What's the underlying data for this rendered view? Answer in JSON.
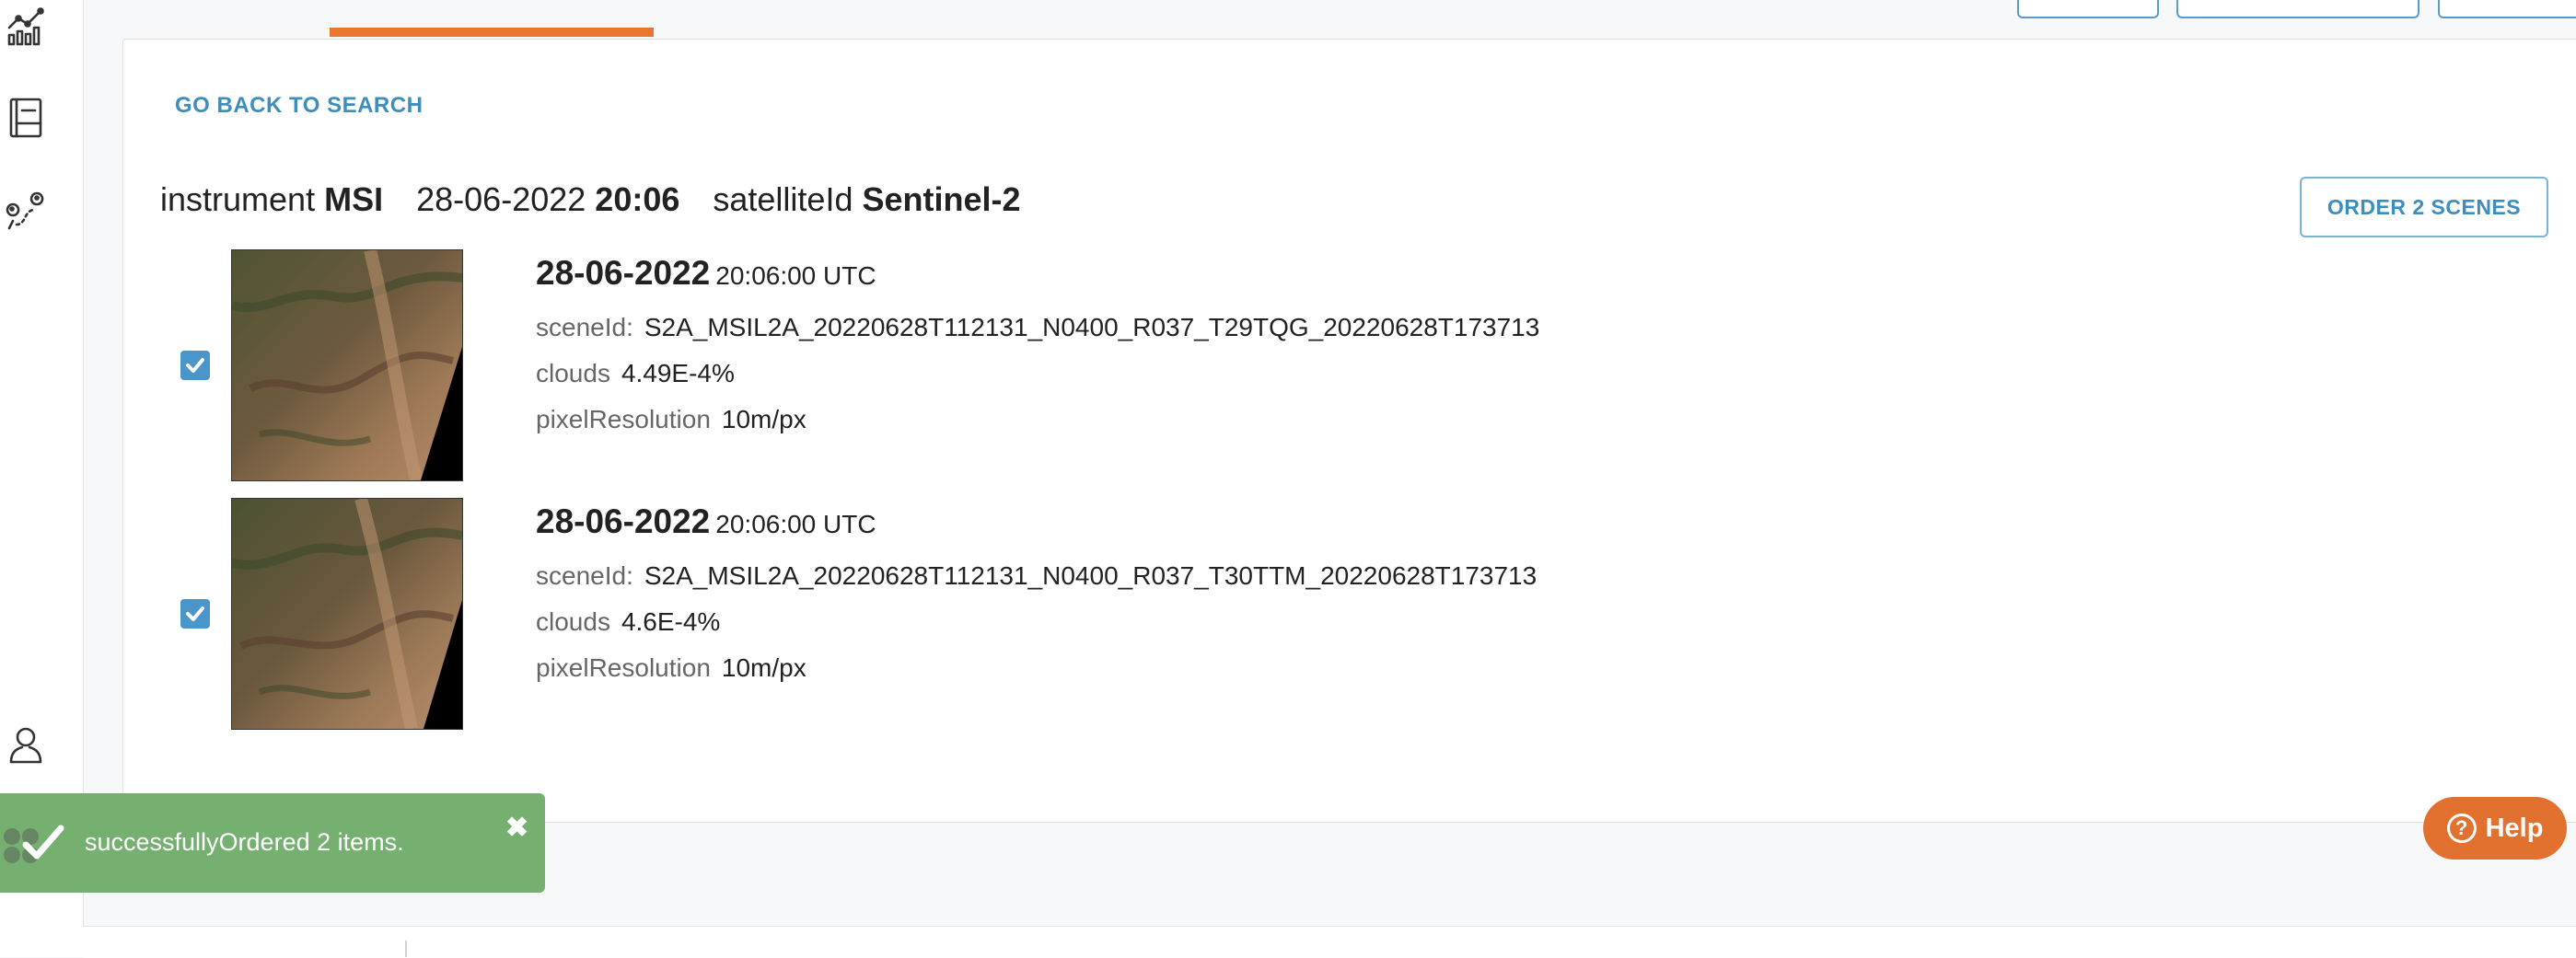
{
  "sidebar": {
    "icons": [
      "chart-icon",
      "notebook-icon",
      "route-icon",
      "user-icon"
    ]
  },
  "actions": {
    "go_back": "GO BACK TO SEARCH",
    "order": "ORDER 2 SCENES"
  },
  "group": {
    "instrument_label": "instrument",
    "instrument_value": "MSI",
    "date": "28-06-2022",
    "time": "20:06",
    "satellite_label": "satelliteId",
    "satellite_value": "Sentinel-2"
  },
  "scenes": [
    {
      "checked": true,
      "date": "28-06-2022",
      "time": "20:06:00 UTC",
      "scene_label": "sceneId:",
      "scene_id": "S2A_MSIL2A_20220628T112131_N0400_R037_T29TQG_20220628T173713",
      "clouds_label": "clouds",
      "clouds": "4.49E-4%",
      "resolution_label": "pixelResolution",
      "resolution": "10m/px"
    },
    {
      "checked": true,
      "date": "28-06-2022",
      "time": "20:06:00 UTC",
      "scene_label": "sceneId:",
      "scene_id": "S2A_MSIL2A_20220628T112131_N0400_R037_T30TTM_20220628T173713",
      "clouds_label": "clouds",
      "clouds": "4.6E-4%",
      "resolution_label": "pixelResolution",
      "resolution": "10m/px"
    }
  ],
  "toast": {
    "message": "successfullyOrdered 2 items.",
    "close": "✖"
  },
  "help": {
    "label": "Help",
    "icon": "?"
  },
  "colors": {
    "accent": "#3d8dbd",
    "tab_active": "#e8772e",
    "toast_bg": "#76b070",
    "help_bg": "#e2702e",
    "checkbox": "#4a95c9"
  }
}
